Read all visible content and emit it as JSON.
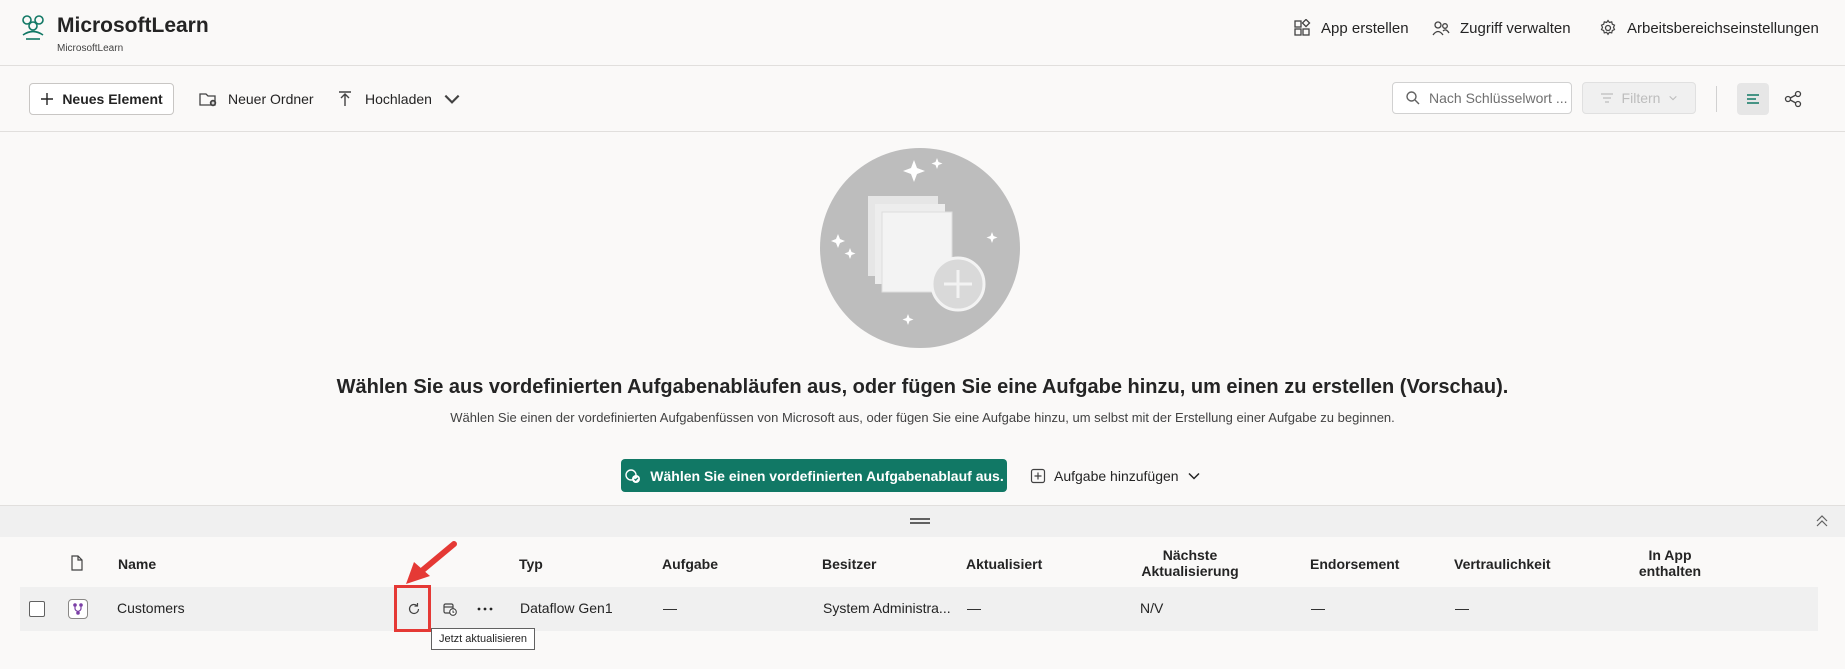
{
  "workspace": {
    "title": "MicrosoftLearn",
    "subtitle": "MicrosoftLearn"
  },
  "header_actions": {
    "create_app": "App erstellen",
    "manage_access": "Zugriff verwalten",
    "workspace_settings": "Arbeitsbereichseinstellungen"
  },
  "toolbar": {
    "new_item": "Neues Element",
    "new_folder": "Neuer Ordner",
    "upload": "Hochladen",
    "search_placeholder": "Nach Schlüsselwort ...",
    "filter": "Filtern"
  },
  "empty_state": {
    "title": "Wählen Sie aus vordefinierten Aufgabenabläufen aus, oder fügen Sie eine Aufgabe hinzu, um einen zu erstellen (Vorschau).",
    "description": "Wählen Sie einen der vordefinierten Aufgabenfüssen von Microsoft aus, oder fügen Sie eine Aufgabe hinzu, um selbst mit der Erstellung einer Aufgabe zu beginnen.",
    "primary_button": "Wählen Sie einen vordefinierten Aufgabenablauf aus.",
    "add_task_button": "Aufgabe hinzufügen"
  },
  "table": {
    "columns": {
      "name": "Name",
      "type": "Typ",
      "task": "Aufgabe",
      "owner": "Besitzer",
      "updated": "Aktualisiert",
      "next_refresh_1": "Nächste",
      "next_refresh_2": "Aktualisierung",
      "endorsement": "Endorsement",
      "sensitivity": "Vertraulichkeit",
      "in_app_1": "In App",
      "in_app_2": "enthalten"
    },
    "rows": [
      {
        "name": "Customers",
        "type": "Dataflow Gen1",
        "task": "—",
        "owner": "System Administra...",
        "updated": "—",
        "next_refresh": "N/V",
        "endorsement": "—",
        "sensitivity": "—"
      }
    ]
  },
  "tooltip": "Jetzt aktualisieren",
  "colors": {
    "primary": "#117865",
    "highlight": "#e53935",
    "dataflow_icon": "#7b3fa6"
  }
}
